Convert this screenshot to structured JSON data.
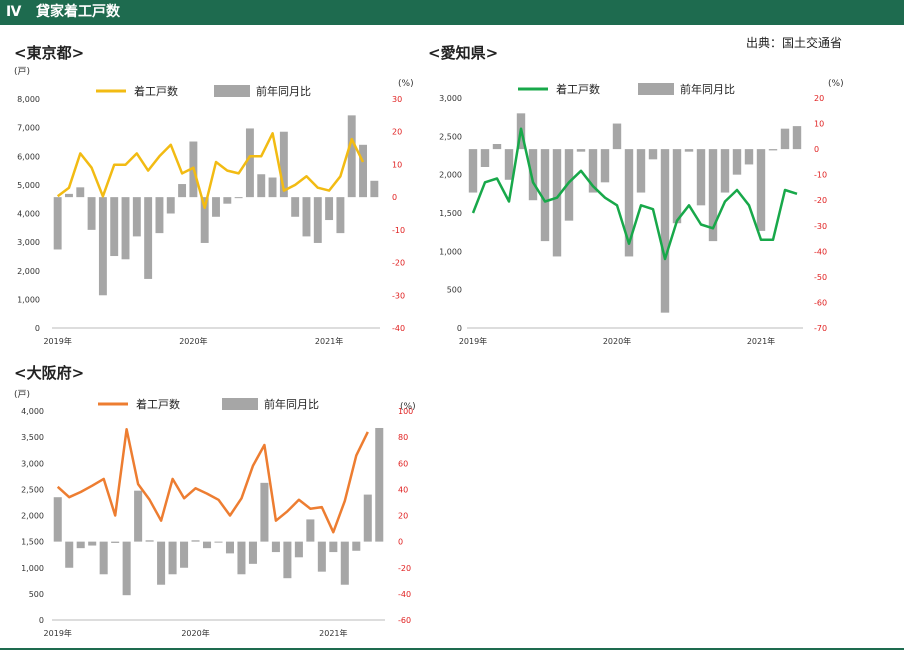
{
  "header": {
    "number": "Ⅳ",
    "title": "貸家着工戸数"
  },
  "source": "出典：国土交通省",
  "colors": {
    "header_bg": "#1e6b4f",
    "bars": "#a6a6a6",
    "tokyo_line": "#f2bb13",
    "aichi_line": "#18a84a",
    "osaka_line": "#ed7d31",
    "right_axis_text": "#e02020"
  },
  "chart_data": [
    {
      "type": "bar+line",
      "title": "<東京都>",
      "left_unit": "(戸)",
      "right_unit": "(%)",
      "legend": [
        "着工戸数",
        "前年同月比"
      ],
      "left_ticks": [
        "0",
        "1,000",
        "2,000",
        "3,000",
        "4,000",
        "5,000",
        "6,000",
        "7,000",
        "8,000"
      ],
      "right_ticks": [
        "-40",
        "-30",
        "-20",
        "-10",
        "0",
        "10",
        "20",
        "30"
      ],
      "left_ylim": [
        0,
        8000
      ],
      "right_ylim": [
        -40,
        30
      ],
      "x_labels": [
        "2019年",
        "2020年",
        "2021年"
      ],
      "x_label_months": [
        0,
        12,
        24
      ],
      "starts": [
        4600,
        4900,
        6100,
        5600,
        4600,
        5700,
        5700,
        6100,
        5500,
        6000,
        6400,
        5400,
        5600,
        4200,
        5800,
        5500,
        5400,
        6000,
        6000,
        6800,
        4800,
        5000,
        5300,
        4900,
        4800,
        5300,
        6600,
        5800
      ],
      "yoy": [
        -16,
        1,
        3,
        -10,
        -30,
        -18,
        -19,
        -12,
        -25,
        -11,
        -5,
        4,
        17,
        -14,
        -6,
        -2,
        0,
        21,
        7,
        6,
        20,
        -6,
        -12,
        -14,
        -7,
        -11,
        25,
        16,
        5
      ]
    },
    {
      "type": "bar+line",
      "title": "<愛知県>",
      "right_unit": "(%)",
      "legend": [
        "着工戸数",
        "前年同月比"
      ],
      "left_ticks": [
        "0",
        "500",
        "1,000",
        "1,500",
        "2,000",
        "2,500",
        "3,000"
      ],
      "right_ticks": [
        "-70",
        "-60",
        "-50",
        "-40",
        "-30",
        "-20",
        "-10",
        "0",
        "10",
        "20"
      ],
      "left_ylim": [
        0,
        3000
      ],
      "right_ylim": [
        -70,
        20
      ],
      "x_labels": [
        "2019年",
        "2020年",
        "2021年"
      ],
      "x_label_months": [
        0,
        12,
        24
      ],
      "starts": [
        1500,
        1900,
        1950,
        1650,
        2600,
        1900,
        1650,
        1700,
        1900,
        2050,
        1850,
        1700,
        1600,
        1100,
        1600,
        1550,
        900,
        1400,
        1600,
        1350,
        1300,
        1650,
        1800,
        1600,
        1150,
        1150,
        1800,
        1750
      ],
      "yoy": [
        -17,
        -7,
        2,
        -12,
        14,
        -20,
        -36,
        -42,
        -28,
        -1,
        -17,
        -13,
        10,
        -42,
        -17,
        -4,
        -64,
        -29,
        -1,
        -22,
        -36,
        -17,
        -10,
        -6,
        -32,
        -0.5,
        8,
        9
      ]
    },
    {
      "type": "bar+line",
      "title": "<大阪府>",
      "left_unit": "(戸)",
      "right_unit": "(%)",
      "legend": [
        "着工戸数",
        "前年同月比"
      ],
      "left_ticks": [
        "0",
        "500",
        "1,000",
        "1,500",
        "2,000",
        "2,500",
        "3,000",
        "3,500",
        "4,000"
      ],
      "right_ticks": [
        "-60",
        "-40",
        "-20",
        "0",
        "20",
        "40",
        "60",
        "80",
        "100"
      ],
      "left_ylim": [
        0,
        4000
      ],
      "right_ylim": [
        -60,
        100
      ],
      "x_labels": [
        "2019年",
        "2020年",
        "2021年"
      ],
      "x_label_months": [
        0,
        12,
        24
      ],
      "starts": [
        2550,
        2350,
        2450,
        2570,
        2700,
        2000,
        3650,
        2600,
        2300,
        1900,
        2700,
        2330,
        2520,
        2420,
        2300,
        2000,
        2330,
        2950,
        3350,
        1900,
        2080,
        2300,
        2130,
        2160,
        1680,
        2280,
        3150,
        3600
      ],
      "yoy": [
        34,
        -20,
        -5,
        -3,
        -25,
        -1,
        -41,
        39,
        1,
        -33,
        -25,
        -20,
        1,
        -5,
        0,
        -9,
        -25,
        -17,
        45,
        -8,
        -28,
        -12,
        17,
        -23,
        -8,
        -33,
        -7,
        36,
        87
      ]
    }
  ]
}
